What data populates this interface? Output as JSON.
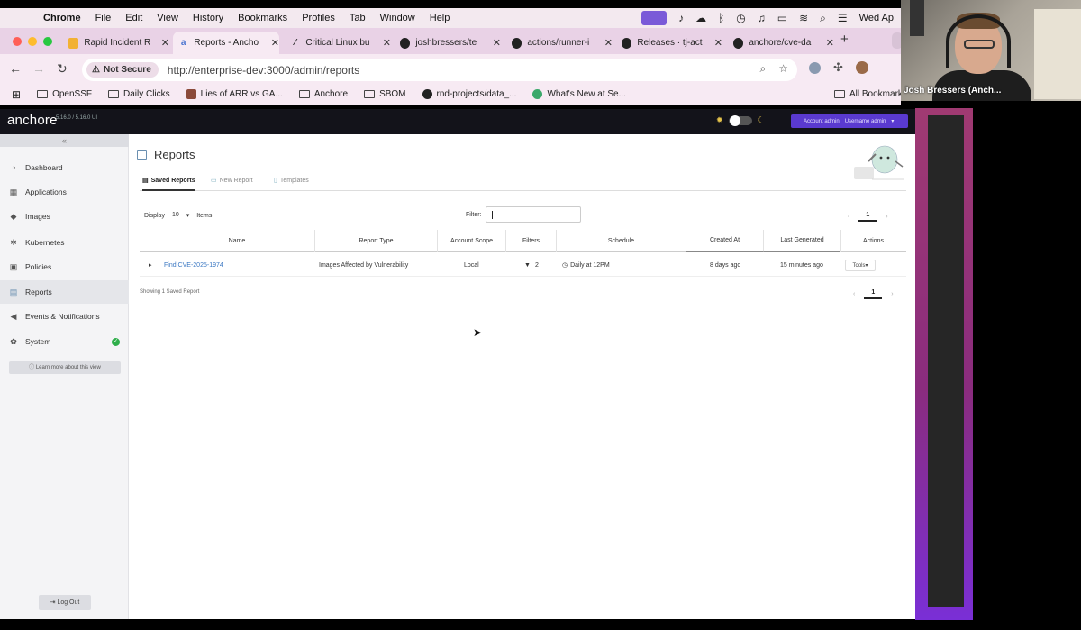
{
  "menubar": {
    "app_name": "Chrome",
    "items": [
      "File",
      "Edit",
      "View",
      "History",
      "Bookmarks",
      "Profiles",
      "Tab",
      "Window",
      "Help"
    ],
    "clock": "Wed Ap"
  },
  "tabs": [
    {
      "title": "Rapid Incident R",
      "favicon": "doc-icon"
    },
    {
      "title": "Reports - Ancho",
      "favicon": "anchore-icon",
      "active": true
    },
    {
      "title": "Critical Linux bu",
      "favicon": "link-icon"
    },
    {
      "title": "joshbressers/te",
      "favicon": "github-icon"
    },
    {
      "title": "actions/runner-i",
      "favicon": "github-icon"
    },
    {
      "title": "Releases · tj-act",
      "favicon": "github-icon"
    },
    {
      "title": "anchore/cve-da",
      "favicon": "github-icon"
    }
  ],
  "omnibox": {
    "security_label": "Not Secure",
    "url": "http://enterprise-dev:3000/admin/reports"
  },
  "bookmarks": [
    {
      "label": "OpenSSF",
      "icon": "folder-icon"
    },
    {
      "label": "Daily Clicks",
      "icon": "folder-icon"
    },
    {
      "label": "Lies of ARR vs GA...",
      "icon": "site-icon"
    },
    {
      "label": "Anchore",
      "icon": "folder-icon"
    },
    {
      "label": "SBOM",
      "icon": "folder-icon"
    },
    {
      "label": "rnd-projects/data_...",
      "icon": "github-icon"
    },
    {
      "label": "What's New at Se...",
      "icon": "site-icon"
    }
  ],
  "bookmarks_all": "All Bookmarks",
  "app": {
    "logo": "anchore",
    "version": "5.16.0 / 5.16.0 UI",
    "account": "Account admin",
    "username": "Username admin",
    "collapse": "«",
    "nav": [
      {
        "label": "Dashboard",
        "icon": "dashboard-icon"
      },
      {
        "label": "Applications",
        "icon": "grid-icon"
      },
      {
        "label": "Images",
        "icon": "tag-icon"
      },
      {
        "label": "Kubernetes",
        "icon": "helm-icon"
      },
      {
        "label": "Policies",
        "icon": "briefcase-icon"
      },
      {
        "label": "Reports",
        "icon": "report-icon",
        "active": true
      },
      {
        "label": "Events & Notifications",
        "icon": "megaphone-icon"
      },
      {
        "label": "System",
        "icon": "gear-icon"
      }
    ],
    "learn_more": "Learn more about this view",
    "logout": "Log Out",
    "page_title": "Reports",
    "page_tabs": [
      "Saved Reports",
      "New Report",
      "Templates"
    ],
    "display_label": "Display",
    "display_value": "10",
    "items_label": "Items",
    "filter_label": "Filter:",
    "page": "1",
    "columns": [
      "Name",
      "Report Type",
      "Account Scope",
      "Filters",
      "Schedule",
      "Created At",
      "Last Generated",
      "Actions"
    ],
    "rows": [
      {
        "name": "Find CVE-2025-1974",
        "type": "Images Affected by Vulnerability",
        "scope": "Local",
        "filters": "2",
        "schedule": "Daily at 12PM",
        "created": "8 days ago",
        "generated": "15 minutes ago",
        "actions": "Tools"
      }
    ],
    "showing": "Showing 1 Saved Report"
  },
  "video": {
    "name": "Josh Bressers (Anch..."
  }
}
